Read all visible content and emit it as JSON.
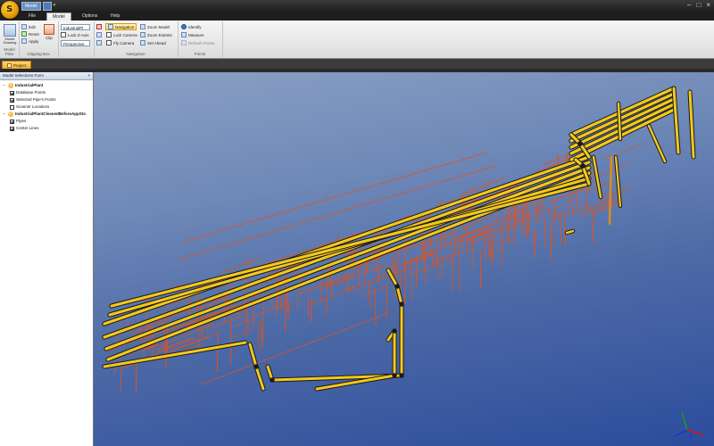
{
  "titlebar": {
    "qat_item": "Model",
    "window_controls": [
      "–",
      "□",
      "×"
    ]
  },
  "tabs": [
    {
      "label": "File",
      "active": false
    },
    {
      "label": "Model",
      "active": true
    },
    {
      "label": "Options",
      "active": false
    },
    {
      "label": "Help",
      "active": false
    }
  ],
  "ribbon": {
    "model_group": {
      "button": "Model Drawing",
      "label": "Model Files"
    },
    "clipping_group": {
      "label": "Clipping Box",
      "edit": "Edit",
      "reset": "Reset",
      "apply": "Apply",
      "clip": "Clip"
    },
    "view_group": {
      "combo_model": "IndustrialPl",
      "lock_z": "Lock Z-Axis",
      "combo_perspective": "Perspective"
    },
    "navigation_group": {
      "label": "Navigation",
      "navigation": "Navigation",
      "lock_camera": "Lock Camera",
      "fly_camera": "Fly Camera",
      "zoom_model": "Zoom Model",
      "zoom_extents": "Zoom Extents",
      "set_ahead": "Set Ahead"
    },
    "points_group": {
      "label": "Points",
      "identify": "Identify",
      "measure": "Measure",
      "refresh_points": "Refresh Points"
    }
  },
  "document_tab": "Project",
  "panel": {
    "title": "Model Selections Form",
    "close": "×",
    "tree": [
      {
        "label": "IndustrialPlant",
        "level": 0,
        "type": "db",
        "checked": true
      },
      {
        "label": "Database Points",
        "level": 1,
        "type": "check",
        "checked": true
      },
      {
        "label": "Selected Pipe's Points",
        "level": 1,
        "type": "check",
        "checked": true
      },
      {
        "label": "Scanner Locations",
        "level": 1,
        "type": "check",
        "checked": false
      },
      {
        "label": "IndustrialPlantCleanedBeforeAppSto",
        "level": 0,
        "type": "db",
        "checked": true
      },
      {
        "label": "Pipes",
        "level": 1,
        "type": "check",
        "checked": true
      },
      {
        "label": "Center Lines",
        "level": 1,
        "type": "check",
        "checked": true
      }
    ]
  },
  "viewport": {
    "pipe_color": "#f2c81d",
    "pipe_outline": "#1a1a1a",
    "point_color": "#e0521d",
    "axis_x_color": "#d11",
    "axis_y_color": "#1a9a2a",
    "axis_z_color": "#2233cc"
  }
}
